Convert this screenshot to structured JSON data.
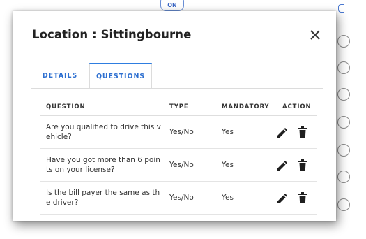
{
  "background": {
    "pill_label": "ON"
  },
  "modal": {
    "title": "Location : Sittingbourne",
    "close_icon": "close-icon"
  },
  "tabs": [
    {
      "label": "DETAILS",
      "active": false
    },
    {
      "label": "QUESTIONS",
      "active": true
    }
  ],
  "table": {
    "headers": {
      "question": "QUESTION",
      "type": "TYPE",
      "mandatory": "MANDATORY",
      "action": "ACTION"
    },
    "rows": [
      {
        "question": "Are you qualified to drive this vehicle?",
        "type": "Yes/No",
        "mandatory": "Yes"
      },
      {
        "question": "Have you got more than 6 points on your license?",
        "type": "Yes/No",
        "mandatory": "Yes"
      },
      {
        "question": "Is the bill payer the same as the driver?",
        "type": "Yes/No",
        "mandatory": "Yes"
      }
    ],
    "row_icons": [
      "pencil-icon",
      "trash-icon"
    ]
  },
  "colors": {
    "accent": "#2d6fd0",
    "text": "#333333",
    "icon": "#1f1f1f"
  }
}
